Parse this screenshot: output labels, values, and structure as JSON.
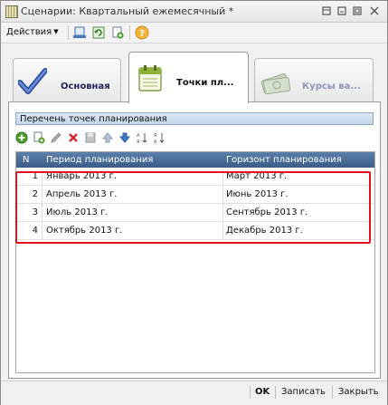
{
  "window": {
    "title": "Сценарии: Квартальный ежемесячный *"
  },
  "toolbar": {
    "actions_label": "Действия"
  },
  "tabs": [
    {
      "label": "Основная",
      "icon": "check-icon"
    },
    {
      "label": "Точки пл...",
      "icon": "calendar-icon"
    },
    {
      "label": "Курсы ва...",
      "icon": "money-icon"
    }
  ],
  "section": {
    "title": "Перечень точек планирования"
  },
  "grid": {
    "columns": [
      "N",
      "Период планирования",
      "Горизонт планирования"
    ],
    "rows": [
      {
        "n": "1",
        "period": "Январь 2013 г.",
        "horizon": "Март 2013 г."
      },
      {
        "n": "2",
        "period": "Апрель 2013 г.",
        "horizon": "Июнь 2013 г."
      },
      {
        "n": "3",
        "period": "Июль 2013 г.",
        "horizon": "Сентябрь 2013 г."
      },
      {
        "n": "4",
        "period": "Октябрь 2013 г.",
        "horizon": "Декабрь 2013 г."
      }
    ]
  },
  "footer": {
    "ok_label": "OK",
    "save_label": "Записать",
    "close_label": "Закрыть"
  },
  "colors": {
    "grid_header": "#3a5c86",
    "highlight_border": "#e0141e"
  }
}
